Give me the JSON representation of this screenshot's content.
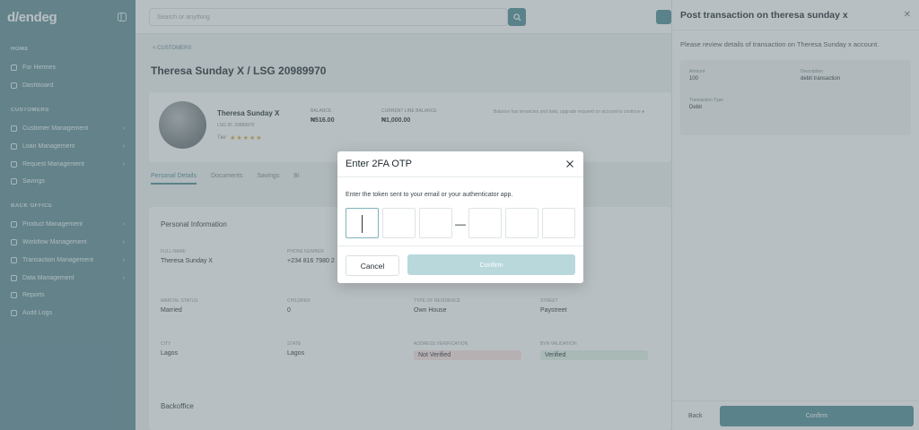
{
  "sidebar": {
    "logo": "d/endeg",
    "sections": [
      {
        "title": "HOME",
        "items": [
          {
            "label": "For Hermes",
            "chev": false
          },
          {
            "label": "Dashboard",
            "chev": false
          }
        ]
      },
      {
        "title": "CUSTOMERS",
        "items": [
          {
            "label": "Customer Management",
            "chev": true
          },
          {
            "label": "Loan Management",
            "chev": true
          },
          {
            "label": "Request Management",
            "chev": true
          },
          {
            "label": "Savings",
            "chev": false
          }
        ]
      },
      {
        "title": "BACK OFFICE",
        "items": [
          {
            "label": "Product Management",
            "chev": true
          },
          {
            "label": "Workflow Management",
            "chev": true
          },
          {
            "label": "Transaction Management",
            "chev": true
          },
          {
            "label": "Data Management",
            "chev": true
          },
          {
            "label": "Reports",
            "chev": false
          },
          {
            "label": "Audit Logs",
            "chev": false
          }
        ]
      }
    ]
  },
  "topbar": {
    "search_placeholder": "Search or anything"
  },
  "page": {
    "breadcrumb": "< CUSTOMERS",
    "title": "Theresa Sunday X / LSG 20989970",
    "profile": {
      "name": "Theresa Sunday X",
      "sub": "LSG ID: 20989970",
      "tier": "Tier",
      "stars": "★★★★★",
      "balance_label": "BALANCE",
      "balance": "₦516.00",
      "ledger_label": "CURRENT LINE BALANCE",
      "ledger": "₦1,000.00",
      "note": "Balance has tenancies and data, upgrade required on account to continue ●"
    },
    "tabs": [
      "Personal Details",
      "Documents",
      "Savings",
      "Bi"
    ],
    "info": {
      "title": "Personal Information",
      "fields": [
        {
          "label": "FULL NAME",
          "value": "Theresa Sunday X"
        },
        {
          "label": "PHONE NUMBER",
          "value": "+234 816 7980 2"
        },
        {
          "label": "MARITAL STATUS",
          "value": "Married"
        },
        {
          "label": "CHILDREN",
          "value": "0"
        },
        {
          "label": "TYPE OF RESIDENCE",
          "value": "Own House"
        },
        {
          "label": "STREET",
          "value": "Paystreet"
        },
        {
          "label": "CITY",
          "value": "Lagos"
        },
        {
          "label": "STATE",
          "value": "Lagos"
        },
        {
          "label": "ADDRESS VERIFICATION",
          "value": "Not Verified"
        },
        {
          "label": "BVN VALIDATION",
          "value": "Verified"
        }
      ],
      "sub_title": "Backoffice"
    }
  },
  "drawer": {
    "title": "Post transaction on theresa sunday x",
    "description": "Please review details of transaction on Theresa Sunday x account.",
    "amount_label": "Amount",
    "amount": "100",
    "description_label": "Description",
    "description_value": "debit transaction",
    "type_label": "Transaction Type",
    "type_value": "Debit",
    "back_label": "Back",
    "confirm_label": "Confirm"
  },
  "modal": {
    "title": "Enter 2FA OTP",
    "instruction": "Enter the token sent to your email or your authenticator app.",
    "separator": "—",
    "otp_values": [
      "",
      "",
      "",
      "",
      "",
      ""
    ],
    "cancel_label": "Cancel",
    "confirm_label": "Confirm"
  },
  "colors": {
    "sidebar": "#5f8d96",
    "accent": "#4f8c95",
    "confirm_disabled": "#b8d8dc",
    "overlay": "rgba(104,118,126,0.47)"
  }
}
